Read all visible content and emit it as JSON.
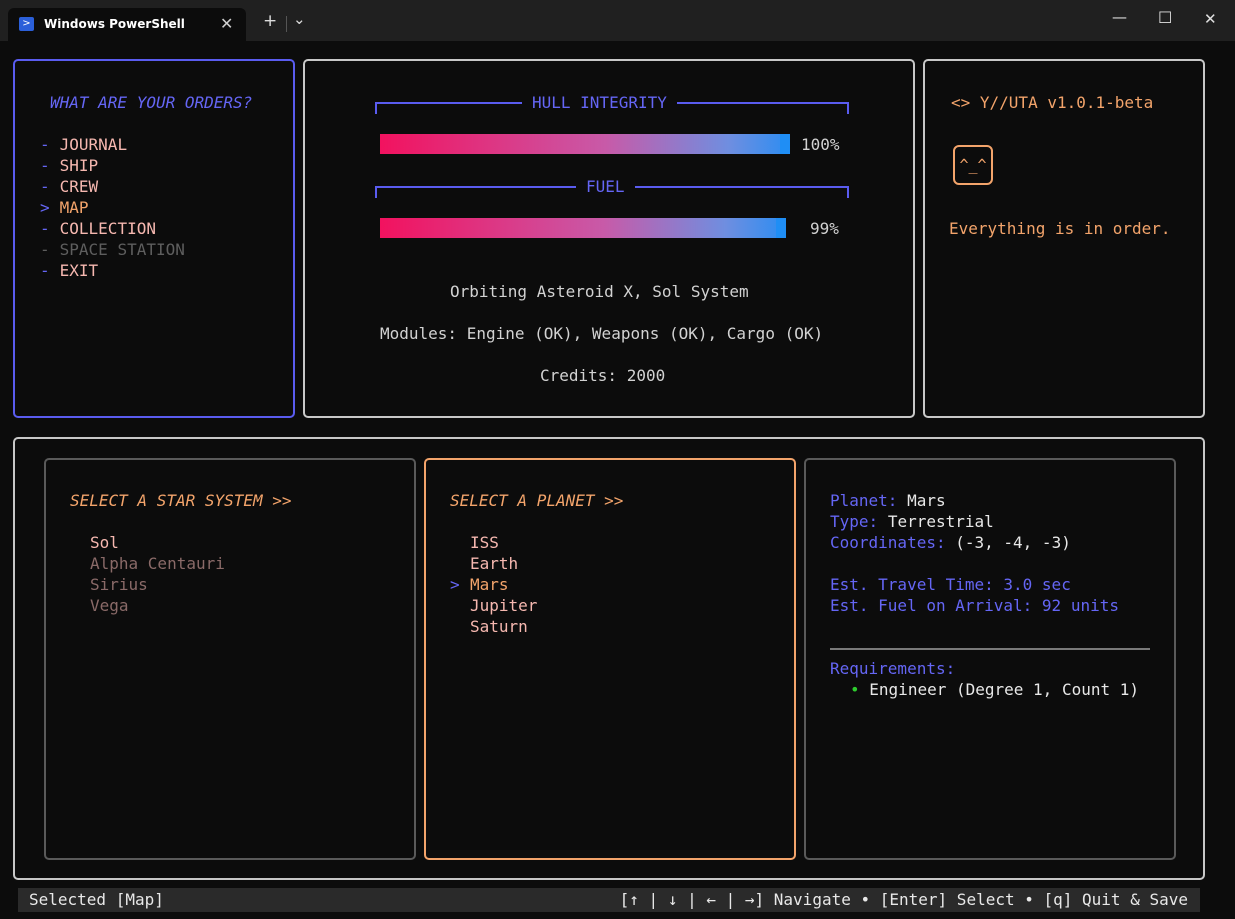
{
  "window": {
    "tab_title": "Windows PowerShell",
    "tab_icon": "powershell-icon",
    "new_tab": "+",
    "dropdown": "⌄",
    "minimize": "—",
    "maximize": "☐",
    "close": "✕"
  },
  "menu": {
    "title": "WHAT ARE YOUR ORDERS?",
    "items": [
      {
        "marker": "-",
        "label": "JOURNAL"
      },
      {
        "marker": "-",
        "label": "SHIP"
      },
      {
        "marker": "-",
        "label": "CREW"
      },
      {
        "marker": ">",
        "label": "MAP"
      },
      {
        "marker": "-",
        "label": "COLLECTION"
      },
      {
        "marker": "-",
        "label": "SPACE STATION"
      },
      {
        "marker": "-",
        "label": "EXIT"
      }
    ]
  },
  "status": {
    "hull_label": "HULL INTEGRITY",
    "hull_value": "100%",
    "hull_fraction": 1.0,
    "fuel_label": "FUEL",
    "fuel_value": "99%",
    "fuel_fraction": 0.99,
    "location": "Orbiting Asteroid X, Sol System",
    "modules": "Modules: Engine (OK), Weapons (OK), Cargo (OK)",
    "credits": "Credits: 2000"
  },
  "assistant": {
    "name": "<> Y//UTA v1.0.1-beta",
    "face": "^_^",
    "message": "Everything is in order."
  },
  "systems": {
    "title": "SELECT A STAR SYSTEM >>",
    "items": [
      "Sol",
      "Alpha Centauri",
      "Sirius",
      "Vega"
    ]
  },
  "planets": {
    "title": "SELECT A PLANET >>",
    "cursor": ">",
    "items": [
      "ISS",
      "Earth",
      "Mars",
      "Jupiter",
      "Saturn"
    ]
  },
  "details": {
    "planet_label": "Planet:",
    "planet_value": "Mars",
    "type_label": "Type:",
    "type_value": "Terrestrial",
    "coords_label": "Coordinates:",
    "coords_value": "(-3, -4, -3)",
    "travel_time": "Est. Travel Time: 3.0 sec",
    "fuel_arrival": "Est. Fuel on Arrival: 92 units",
    "req_label": "Requirements:",
    "req_bullet": "•",
    "req_item": "Engineer (Degree 1, Count 1)"
  },
  "statusbar": {
    "left": "Selected [Map]",
    "right": "[↑ | ↓ | ← | →] Navigate • [Enter] Select • [q] Quit & Save"
  },
  "colors": {
    "accent_blue": "#5a5cf0",
    "accent_orange": "#f3a46b",
    "bar_start": "#f2125f",
    "bar_end": "#2c8df2",
    "ok_green": "#2ecc2e"
  }
}
